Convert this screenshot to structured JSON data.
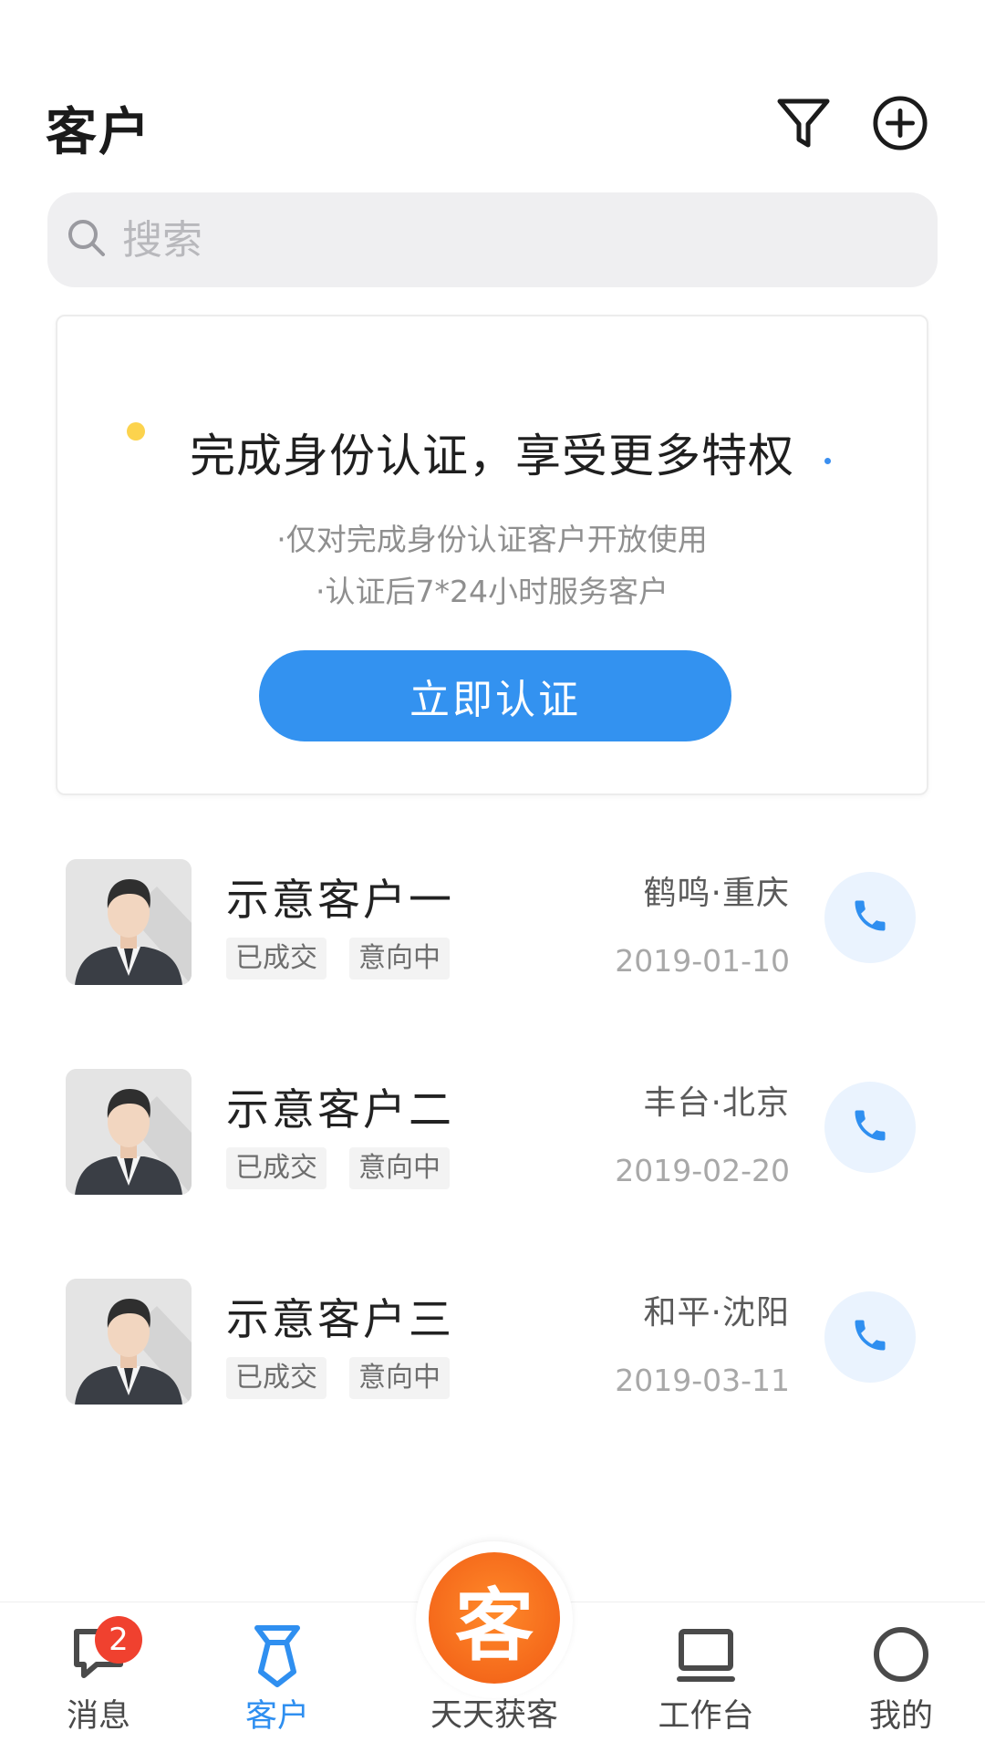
{
  "header": {
    "title": "客户"
  },
  "search": {
    "placeholder": "搜索"
  },
  "verify_card": {
    "title": "完成身份认证，享受更多特权",
    "line1": "·仅对完成身份认证客户开放使用",
    "line2": "·认证后7*24小时服务客户",
    "button_label": "立即认证"
  },
  "customers": [
    {
      "name": "示意客户一",
      "tags": [
        "已成交",
        "意向中"
      ],
      "location": "鹤鸣·重庆",
      "date": "2019-01-10"
    },
    {
      "name": "示意客户二",
      "tags": [
        "已成交",
        "意向中"
      ],
      "location": "丰台·北京",
      "date": "2019-02-20"
    },
    {
      "name": "示意客户三",
      "tags": [
        "已成交",
        "意向中"
      ],
      "location": "和平·沈阳",
      "date": "2019-03-11"
    }
  ],
  "tabbar": {
    "messages": {
      "label": "消息",
      "badge": "2",
      "icon": "chat-icon"
    },
    "customers": {
      "label": "客户",
      "icon": "tie-icon"
    },
    "center": {
      "label": "天天获客",
      "glyph": "客"
    },
    "workbench": {
      "label": "工作台",
      "icon": "laptop-icon"
    },
    "mine": {
      "label": "我的",
      "icon": "circle-icon"
    }
  },
  "colors": {
    "accent": "#3392f0",
    "badge": "#f0412f",
    "center": "#f26b1d"
  }
}
